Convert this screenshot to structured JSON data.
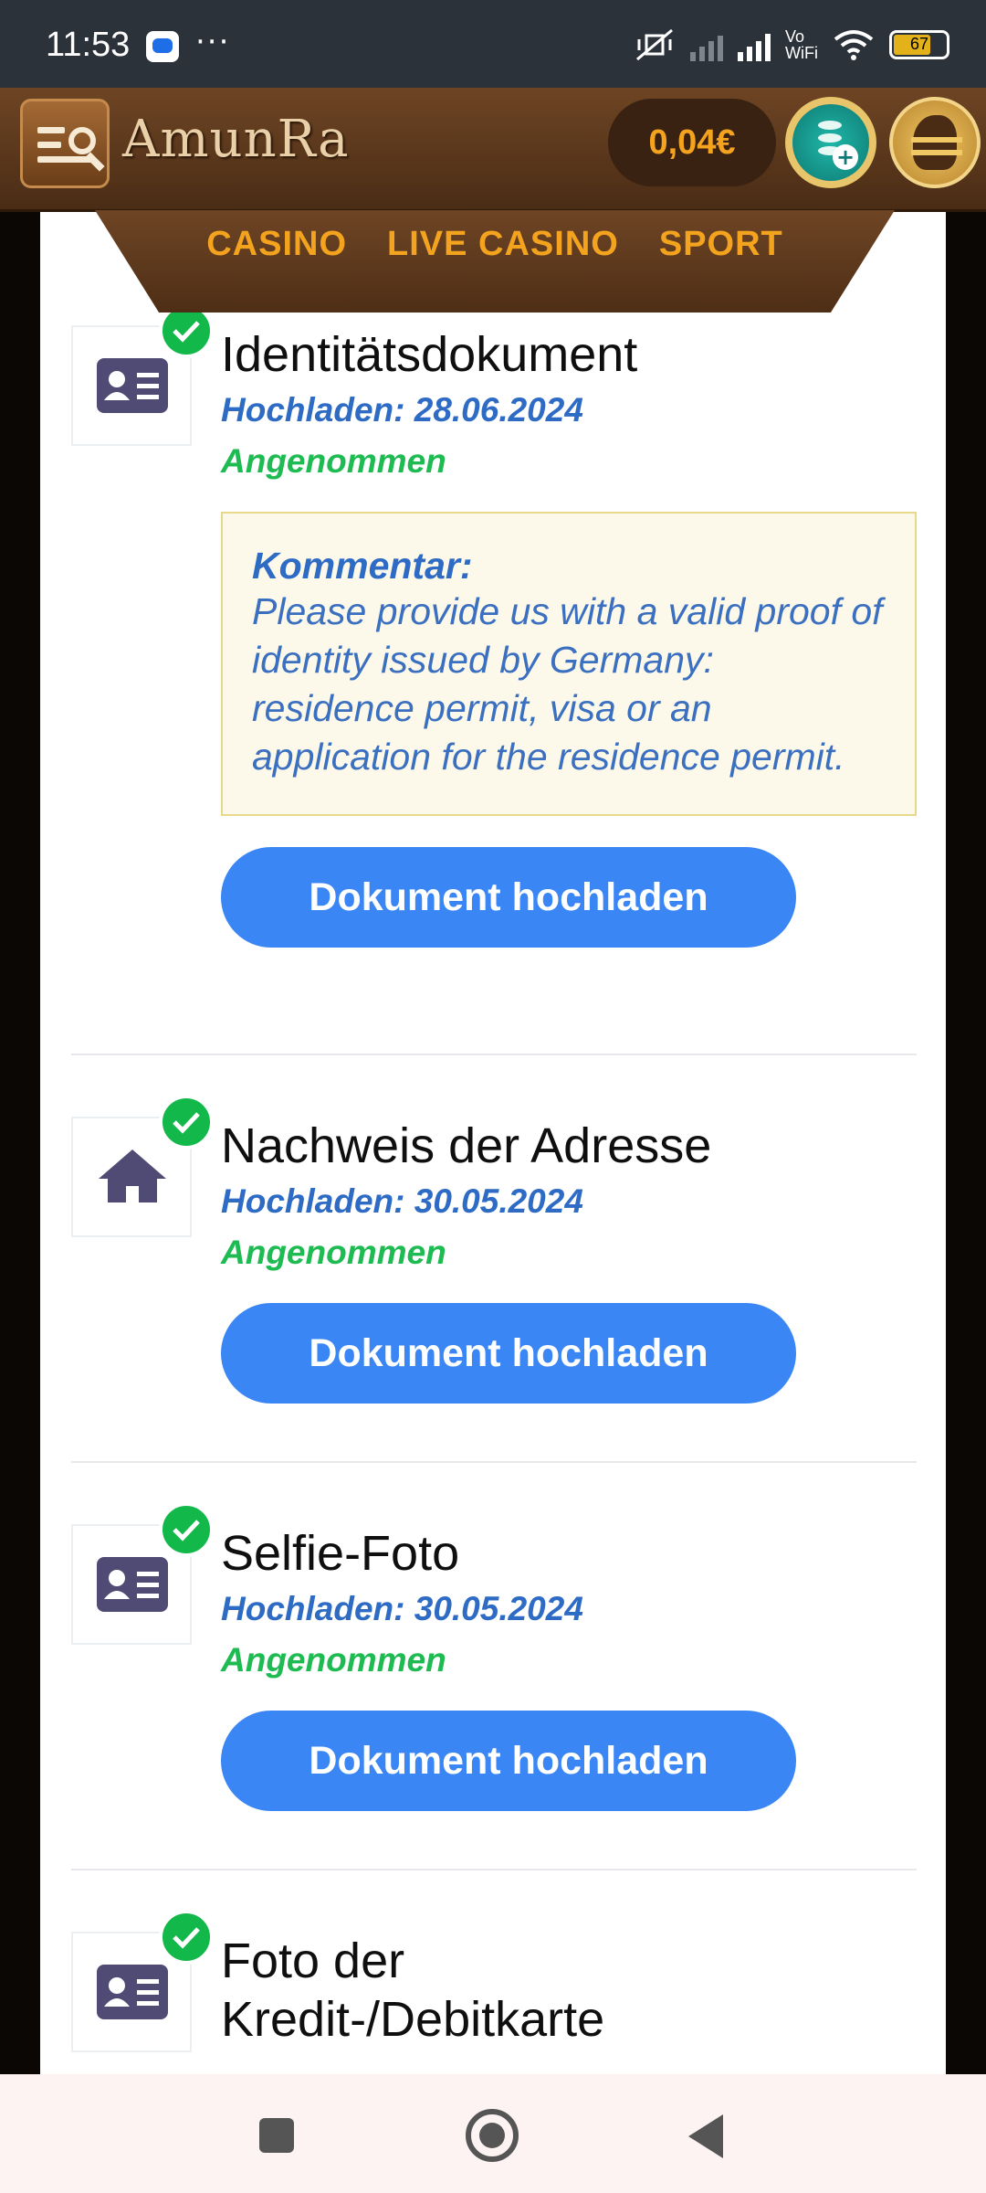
{
  "status_bar": {
    "time": "11:53",
    "dots": "···",
    "vowifi_top": "Vo",
    "vowifi_bottom": "WiFi",
    "battery": "67"
  },
  "header": {
    "logo": "AmunRa",
    "balance": "0,04€"
  },
  "nav": {
    "items": [
      "CASINO",
      "LIVE CASINO",
      "SPORT"
    ]
  },
  "documents": [
    {
      "title": "Identitätsdokument",
      "date": "Hochladen: 28.06.2024",
      "status": "Angenommen",
      "icon": "id-card-icon",
      "comment_label": "Kommentar:",
      "comment_text": "Please provide us with a valid proof of identity issued by Germany: residence permit, visa or an application for the residence permit.",
      "button": "Dokument hochladen"
    },
    {
      "title": "Nachweis der Adresse",
      "date": "Hochladen: 30.05.2024",
      "status": "Angenommen",
      "icon": "house-icon",
      "button": "Dokument hochladen"
    },
    {
      "title": "Selfie-Foto",
      "date": "Hochladen: 30.05.2024",
      "status": "Angenommen",
      "icon": "id-card-icon",
      "button": "Dokument hochladen"
    },
    {
      "title_line1": "Foto der",
      "title_line2": "Kredit-/Debitkarte",
      "icon": "id-card-icon"
    }
  ],
  "colors": {
    "accent_blue": "#3a86f5",
    "date_blue": "#2e6bc4",
    "status_green": "#1dbb52",
    "header_brown": "#6e4524",
    "nav_orange": "#f4a31e"
  }
}
